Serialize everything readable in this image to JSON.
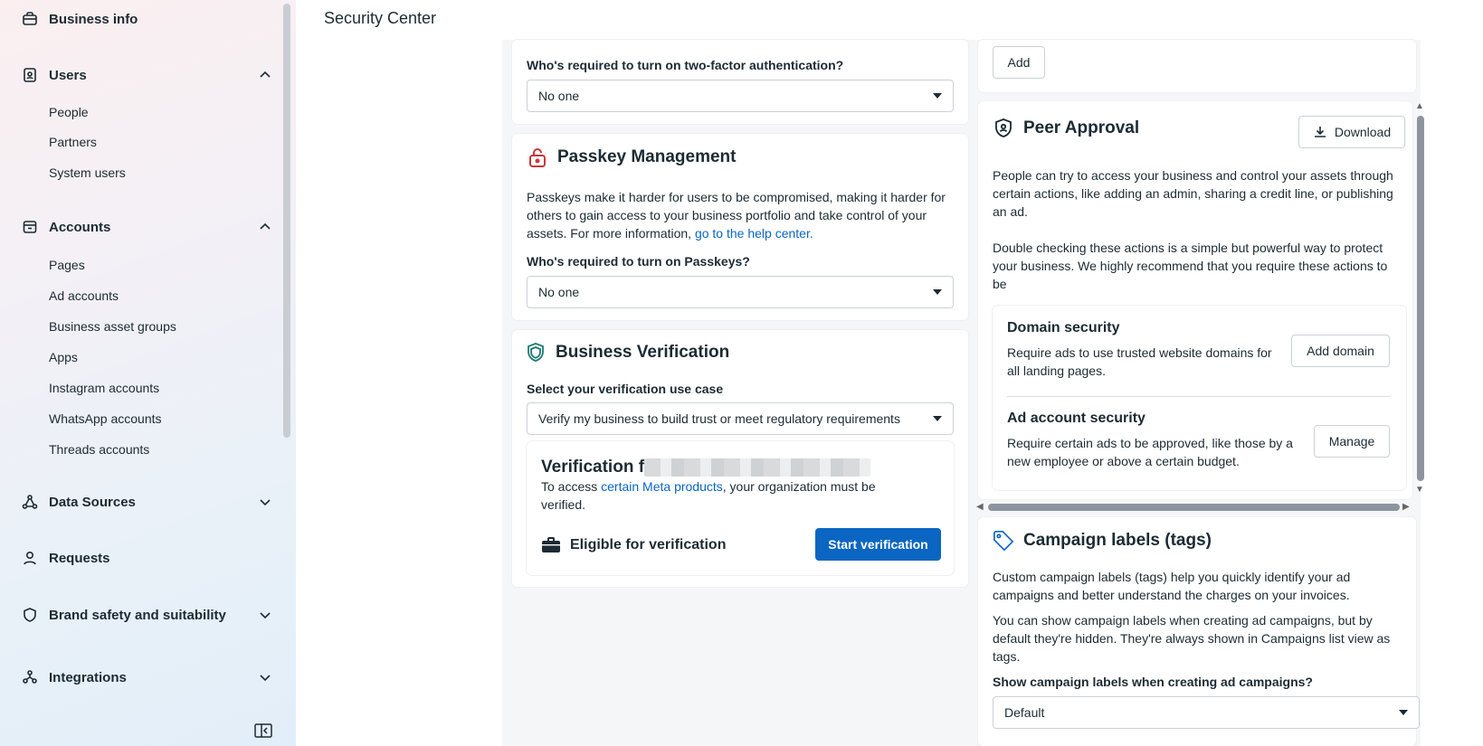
{
  "header": {
    "title": "Security Center"
  },
  "sidebar": {
    "sections": [
      {
        "label": "Business info",
        "icon": "briefcase-icon"
      },
      {
        "label": "Users",
        "icon": "id-badge-icon",
        "expanded": true,
        "items": [
          "People",
          "Partners",
          "System users"
        ]
      },
      {
        "label": "Accounts",
        "icon": "folder-icon",
        "expanded": true,
        "items": [
          "Pages",
          "Ad accounts",
          "Business asset groups",
          "Apps",
          "Instagram accounts",
          "WhatsApp accounts",
          "Threads accounts"
        ]
      },
      {
        "label": "Data Sources",
        "icon": "nodes-icon",
        "expanded": false
      },
      {
        "label": "Requests",
        "icon": "person-icon",
        "expanded": false
      },
      {
        "label": "Brand safety and suitability",
        "icon": "shield-icon",
        "expanded": false
      },
      {
        "label": "Integrations",
        "icon": "integrations-icon",
        "expanded": false
      }
    ]
  },
  "two_factor": {
    "question": "Who's required to turn on two-factor authentication?",
    "value": "No one"
  },
  "passkey": {
    "title": "Passkey Management",
    "desc": "Passkeys make it harder for users to be compromised, making it harder for others to gain access to your business portfolio and take control of your assets. For more information,",
    "link": "go to the help center.",
    "question": "Who's required to turn on Passkeys?",
    "value": "No one"
  },
  "verification": {
    "title": "Business Verification",
    "select_label": "Select your verification use case",
    "select_value": "Verify my business to build trust or meet regulatory requirements",
    "box_title": "Verification f",
    "access_prefix": "To access",
    "access_link": "certain Meta products",
    "access_suffix": ", your organization must be verified.",
    "eligible": "Eligible for verification",
    "start_button": "Start verification"
  },
  "right_top": {
    "add_button": "Add"
  },
  "peer_approval": {
    "title": "Peer Approval",
    "download_button": "Download",
    "p1": "People can try to access your business and control your assets through certain actions, like adding an admin, sharing a credit line, or publishing an ad.",
    "p2": "Double checking these actions is a simple but powerful way to protect your business. We highly recommend that you require these actions to be",
    "domain_title": "Domain security",
    "domain_desc": "Require ads to use trusted website domains for all landing pages.",
    "domain_button": "Add domain",
    "adacct_title": "Ad account security",
    "adacct_desc": "Require certain ads to be approved, like those by a new employee or above a certain budget.",
    "adacct_button": "Manage"
  },
  "campaign_labels": {
    "title": "Campaign labels (tags)",
    "p1": "Custom campaign labels (tags) help you quickly identify your ad campaigns and better understand the charges on your invoices.",
    "p2": "You can show campaign labels when creating ad campaigns, but by default they're hidden. They're always shown in Campaigns list view as tags.",
    "question": "Show campaign labels when creating ad campaigns?",
    "value": "Default"
  }
}
